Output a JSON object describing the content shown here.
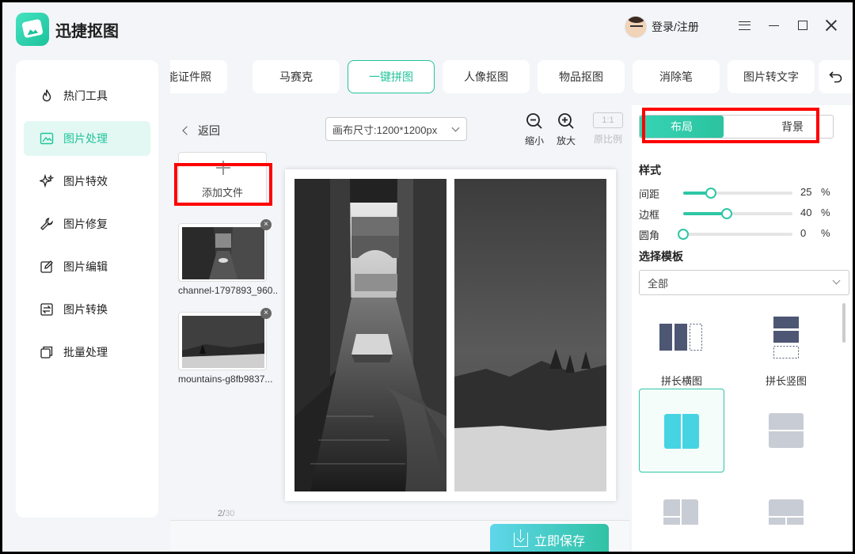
{
  "app": {
    "title": "迅捷抠图",
    "user_label": "登录/注册"
  },
  "sidebar": {
    "items": [
      {
        "label": "热门工具",
        "icon": "flame-icon"
      },
      {
        "label": "图片处理",
        "icon": "image-process-icon",
        "active": true
      },
      {
        "label": "图片特效",
        "icon": "sparkle-icon"
      },
      {
        "label": "图片修复",
        "icon": "wrench-icon"
      },
      {
        "label": "图片编辑",
        "icon": "edit-icon"
      },
      {
        "label": "图片转换",
        "icon": "convert-icon"
      },
      {
        "label": "批量处理",
        "icon": "batch-icon"
      }
    ]
  },
  "tabs": [
    {
      "label": "智能证件照"
    },
    {
      "label": "马赛克"
    },
    {
      "label": "一键拼图",
      "active": true
    },
    {
      "label": "人像抠图"
    },
    {
      "label": "物品抠图"
    },
    {
      "label": "消除笔"
    },
    {
      "label": "图片转文字"
    }
  ],
  "toolbar": {
    "back_label": "返回",
    "canvas_size": "画布尺寸:1200*1200px",
    "zoom_out_label": "缩小",
    "zoom_in_label": "放大",
    "original_ratio_box": "1:1",
    "original_ratio_label": "原比例"
  },
  "files": {
    "add_label": "添加文件",
    "items": [
      {
        "name": "channel-1797893_960..."
      },
      {
        "name": "mountains-g8fb9837..."
      }
    ],
    "page_current": "2/",
    "page_total": "30"
  },
  "save_label": "立即保存",
  "right_panel": {
    "seg_layout": "布局",
    "seg_background": "背景",
    "style_title": "样式",
    "sliders": [
      {
        "label": "间距",
        "value": "25",
        "unit": "%",
        "level": 0.25
      },
      {
        "label": "边框",
        "value": "40",
        "unit": "%",
        "level": 0.4
      },
      {
        "label": "圆角",
        "value": "0",
        "unit": "%",
        "level": 0
      }
    ],
    "template_title": "选择模板",
    "template_filter": "全部",
    "templates": [
      {
        "name": "拼长横图"
      },
      {
        "name": "拼长竖图"
      }
    ]
  },
  "colors": {
    "accent": "#21c39c",
    "highlight": "#ff0000",
    "template_fill": "#4d5773"
  }
}
